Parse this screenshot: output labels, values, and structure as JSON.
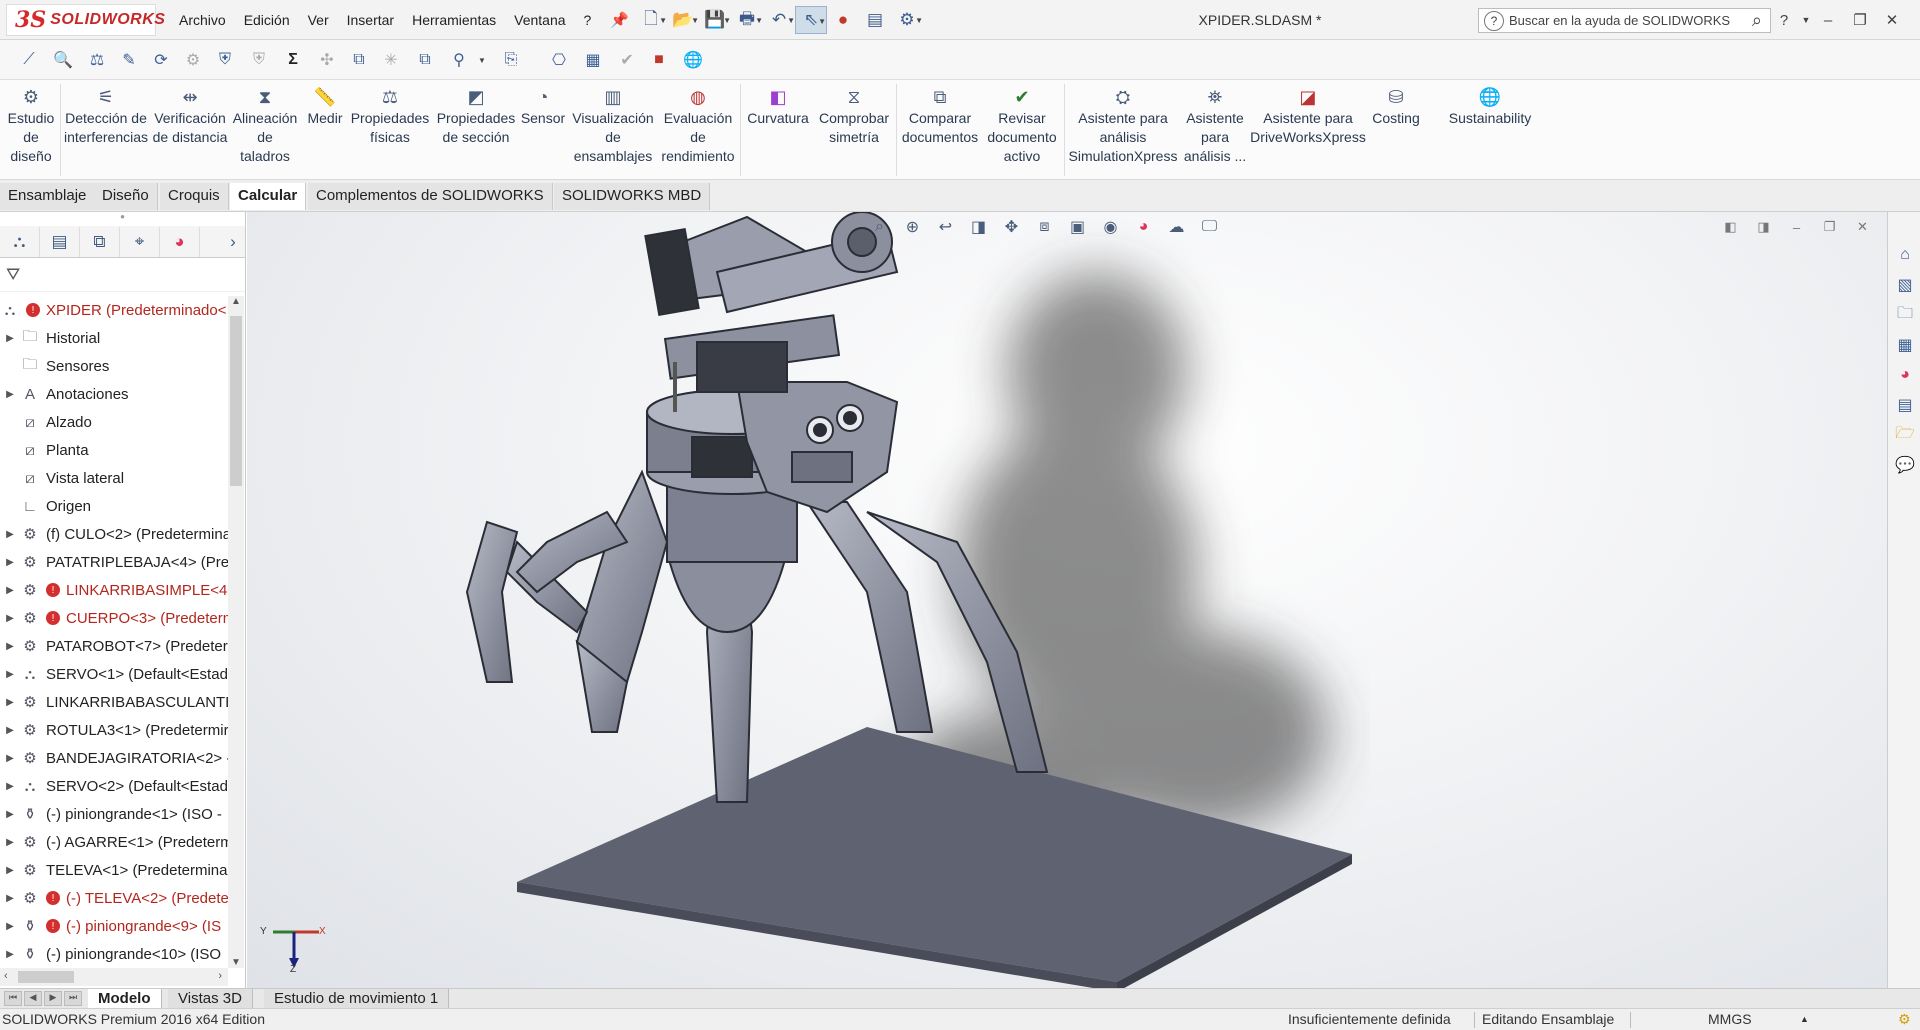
{
  "app": {
    "logo_text": "SOLIDWORKS",
    "document_title": "XPIDER.SLDASM *"
  },
  "menu": {
    "items": [
      "Archivo",
      "Edición",
      "Ver",
      "Insertar",
      "Herramientas",
      "Ventana",
      "?"
    ]
  },
  "help_search": {
    "placeholder": "Buscar en la ayuda de SOLIDWORKS"
  },
  "ribbon": {
    "commands": [
      {
        "label": "Estudio de diseño",
        "icon": "design-study-icon"
      },
      {
        "label": "Detección de interferencias",
        "icon": "interference-icon"
      },
      {
        "label": "Verificación de distancia",
        "icon": "clearance-icon"
      },
      {
        "label": "Alineación de taladros",
        "icon": "hole-alignment-icon"
      },
      {
        "label": "Medir",
        "icon": "measure-icon"
      },
      {
        "label": "Propiedades físicas",
        "icon": "mass-properties-icon"
      },
      {
        "label": "Propiedades de sección",
        "icon": "section-properties-icon"
      },
      {
        "label": "Sensor",
        "icon": "sensor-icon"
      },
      {
        "label": "Visualización de ensamblajes",
        "icon": "assembly-visualization-icon"
      },
      {
        "label": "Evaluación de rendimiento",
        "icon": "performance-evaluation-icon"
      },
      {
        "label": "Curvatura",
        "icon": "curvature-icon"
      },
      {
        "label": "Comprobar simetría",
        "icon": "symmetry-check-icon"
      },
      {
        "label": "Comparar documentos",
        "icon": "compare-documents-icon"
      },
      {
        "label": "Revisar documento activo",
        "icon": "check-active-document-icon"
      },
      {
        "label": "Asistente para análisis SimulationXpress",
        "icon": "simulationxpress-icon"
      },
      {
        "label": "Asistente para análisis ...",
        "icon": "analysis-wizard-icon"
      },
      {
        "label": "Asistente para DriveWorksXpress",
        "icon": "driveworksxpress-icon"
      },
      {
        "label": "Costing",
        "icon": "costing-icon"
      },
      {
        "label": "Sustainability",
        "icon": "sustainability-icon"
      }
    ]
  },
  "command_tabs": [
    "Ensamblaje",
    "Diseño",
    "Croquis",
    "Calcular",
    "Complementos de SOLIDWORKS",
    "SOLIDWORKS MBD"
  ],
  "active_command_tab": "Calcular",
  "tree": {
    "root": "XPIDER  (Predeterminado<",
    "items": [
      {
        "label": "Historial",
        "icon": "history-folder-icon",
        "expandable": true,
        "error": false
      },
      {
        "label": "Sensores",
        "icon": "sensors-folder-icon",
        "expandable": false,
        "error": false
      },
      {
        "label": "Anotaciones",
        "icon": "annotations-icon",
        "expandable": true,
        "error": false
      },
      {
        "label": "Alzado",
        "icon": "plane-icon",
        "expandable": false,
        "error": false
      },
      {
        "label": "Planta",
        "icon": "plane-icon",
        "expandable": false,
        "error": false
      },
      {
        "label": "Vista lateral",
        "icon": "plane-icon",
        "expandable": false,
        "error": false
      },
      {
        "label": "Origen",
        "icon": "origin-icon",
        "expandable": false,
        "error": false
      },
      {
        "label": "(f) CULO<2> (Predetermina",
        "icon": "part-icon",
        "expandable": true,
        "error": false
      },
      {
        "label": "PATATRIPLEBAJA<4> (Prec",
        "icon": "part-icon",
        "expandable": true,
        "error": false
      },
      {
        "label": "LINKARRIBASIMPLE<4>",
        "icon": "part-icon",
        "expandable": true,
        "error": true
      },
      {
        "label": "CUERPO<3> (Predeterm",
        "icon": "part-icon",
        "expandable": true,
        "error": true
      },
      {
        "label": "PATAROBOT<7> (Predeter",
        "icon": "part-icon",
        "expandable": true,
        "error": false
      },
      {
        "label": "SERVO<1> (Default<Estad",
        "icon": "subassembly-icon",
        "expandable": true,
        "error": false
      },
      {
        "label": "LINKARRIBABASCULANTE<",
        "icon": "part-icon",
        "expandable": true,
        "error": false
      },
      {
        "label": "ROTULA3<1> (Predetermir",
        "icon": "part-icon",
        "expandable": true,
        "error": false
      },
      {
        "label": "BANDEJAGIRATORIA<2> -",
        "icon": "part-icon",
        "expandable": true,
        "error": false
      },
      {
        "label": "SERVO<2> (Default<Estad",
        "icon": "subassembly-icon",
        "expandable": true,
        "error": false
      },
      {
        "label": "(-) piniongrande<1> (ISO -",
        "icon": "toolbox-part-icon",
        "expandable": true,
        "error": false
      },
      {
        "label": "(-) AGARRE<1> (Predeterm",
        "icon": "part-icon",
        "expandable": true,
        "error": false
      },
      {
        "label": "TELEVA<1> (Predetermina",
        "icon": "part-icon",
        "expandable": true,
        "error": false
      },
      {
        "label": "(-) TELEVA<2> (Predete",
        "icon": "part-icon",
        "expandable": true,
        "error": true
      },
      {
        "label": "(-) piniongrande<9> (IS",
        "icon": "toolbox-part-icon",
        "expandable": true,
        "error": true
      },
      {
        "label": "(-) piniongrande<10> (ISO",
        "icon": "toolbox-part-icon",
        "expandable": true,
        "error": false
      }
    ]
  },
  "triad": {
    "x": "X",
    "y": "Y",
    "z": "Z"
  },
  "bottom_tabs": [
    "Modelo",
    "Vistas 3D",
    "Estudio de movimiento 1"
  ],
  "active_bottom_tab": "Modelo",
  "status": {
    "edition": "SOLIDWORKS Premium 2016 x64 Edition",
    "definition": "Insuficientemente definida",
    "mode": "Editando Ensamblaje",
    "units": "MMGS"
  },
  "colors": {
    "brand_red": "#c62828",
    "error_red": "#d32f2f",
    "tree_error_text": "#b3261e",
    "model_gray": "#8a8e9c",
    "floor_plate": "#5f6270"
  }
}
